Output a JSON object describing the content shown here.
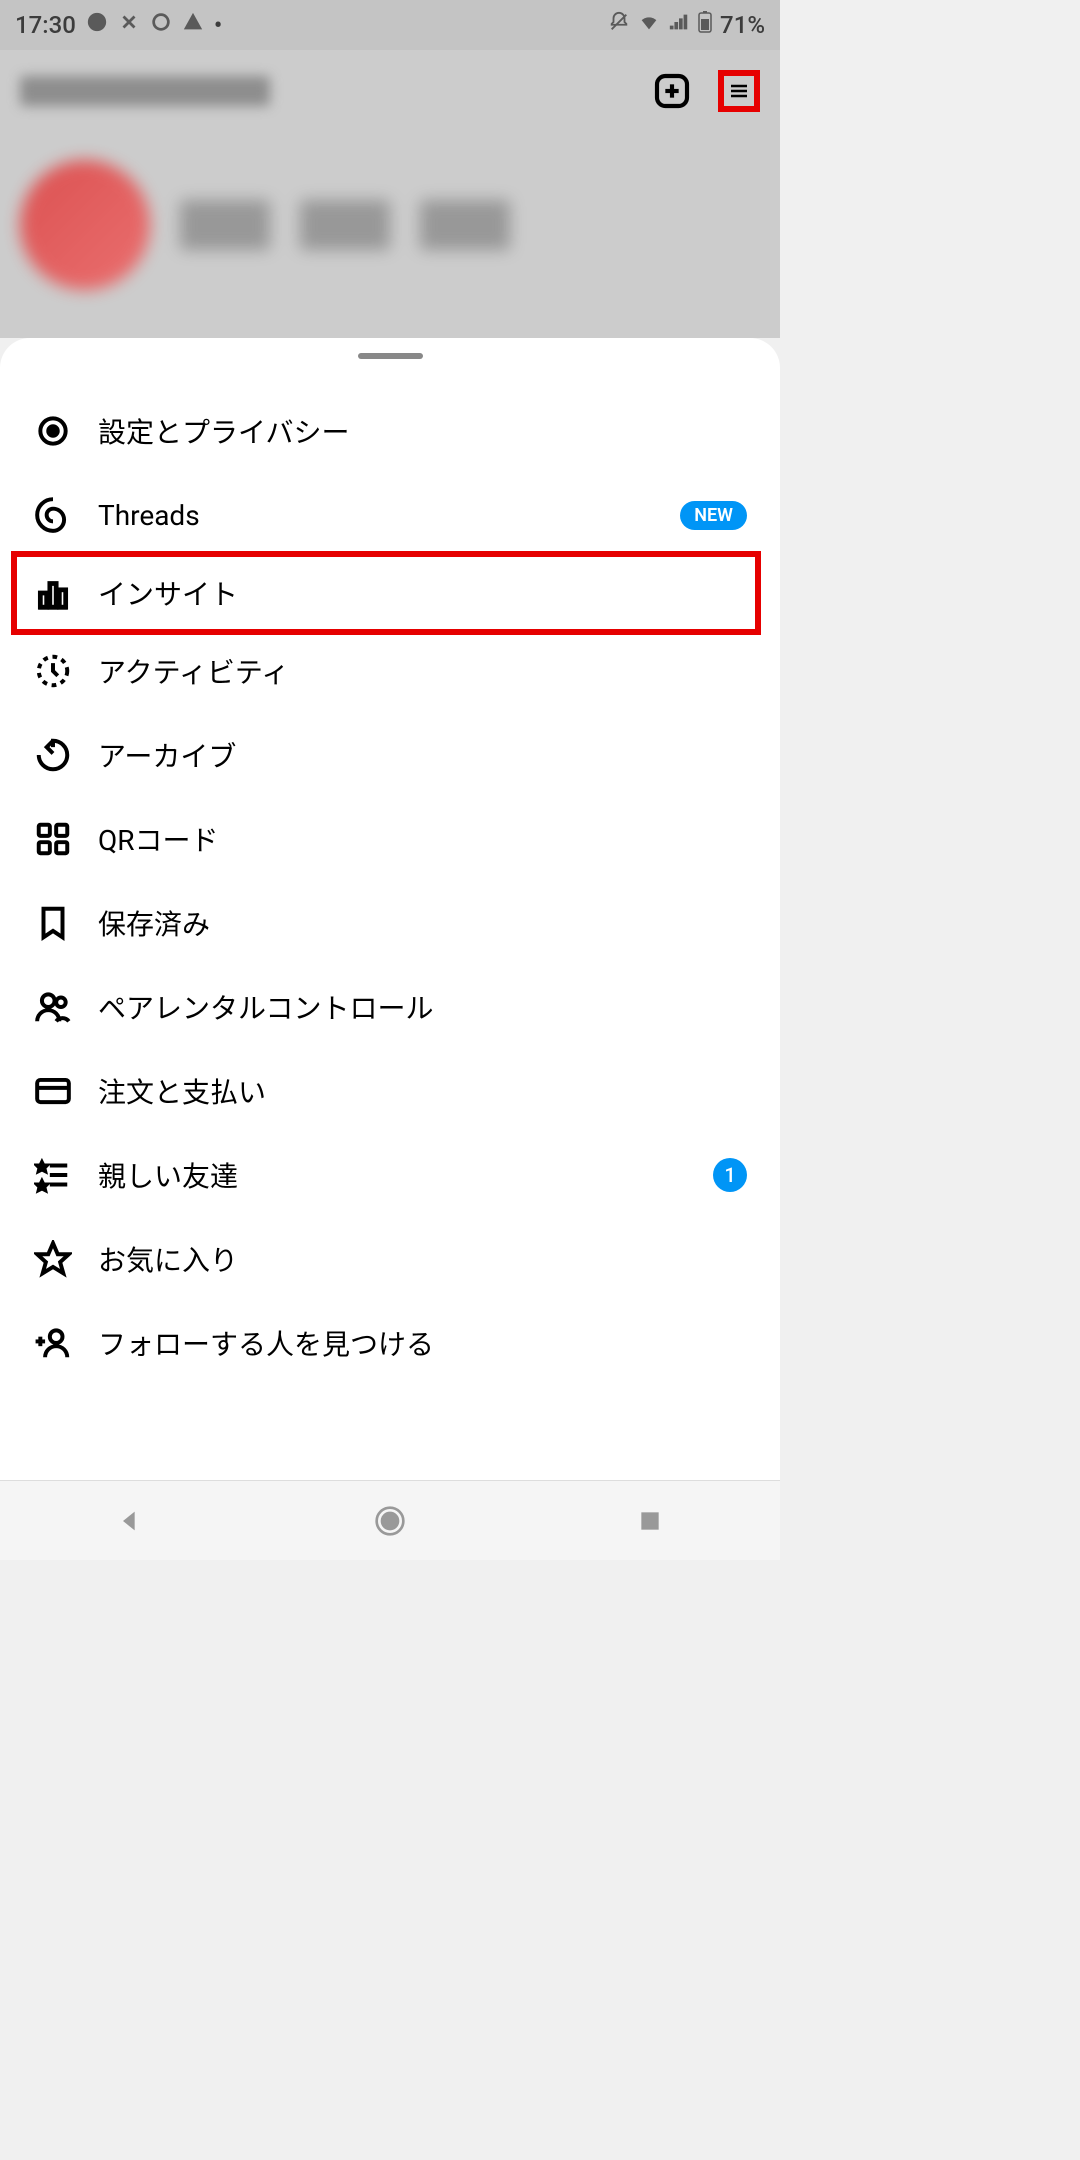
{
  "status": {
    "time": "17:30",
    "battery": "71%"
  },
  "menu": {
    "items": [
      {
        "label": "設定とプライバシー",
        "icon": "settings"
      },
      {
        "label": "Threads",
        "icon": "threads",
        "badge_new": "NEW"
      },
      {
        "label": "インサイト",
        "icon": "insights",
        "highlighted": true
      },
      {
        "label": "アクティビティ",
        "icon": "activity"
      },
      {
        "label": "アーカイブ",
        "icon": "archive"
      },
      {
        "label": "QRコード",
        "icon": "qr"
      },
      {
        "label": "保存済み",
        "icon": "saved"
      },
      {
        "label": "ペアレンタルコントロール",
        "icon": "parental"
      },
      {
        "label": "注文と支払い",
        "icon": "payment"
      },
      {
        "label": "親しい友達",
        "icon": "close-friends",
        "badge_count": "1"
      },
      {
        "label": "お気に入り",
        "icon": "favorites"
      },
      {
        "label": "フォローする人を見つける",
        "icon": "discover"
      }
    ]
  }
}
